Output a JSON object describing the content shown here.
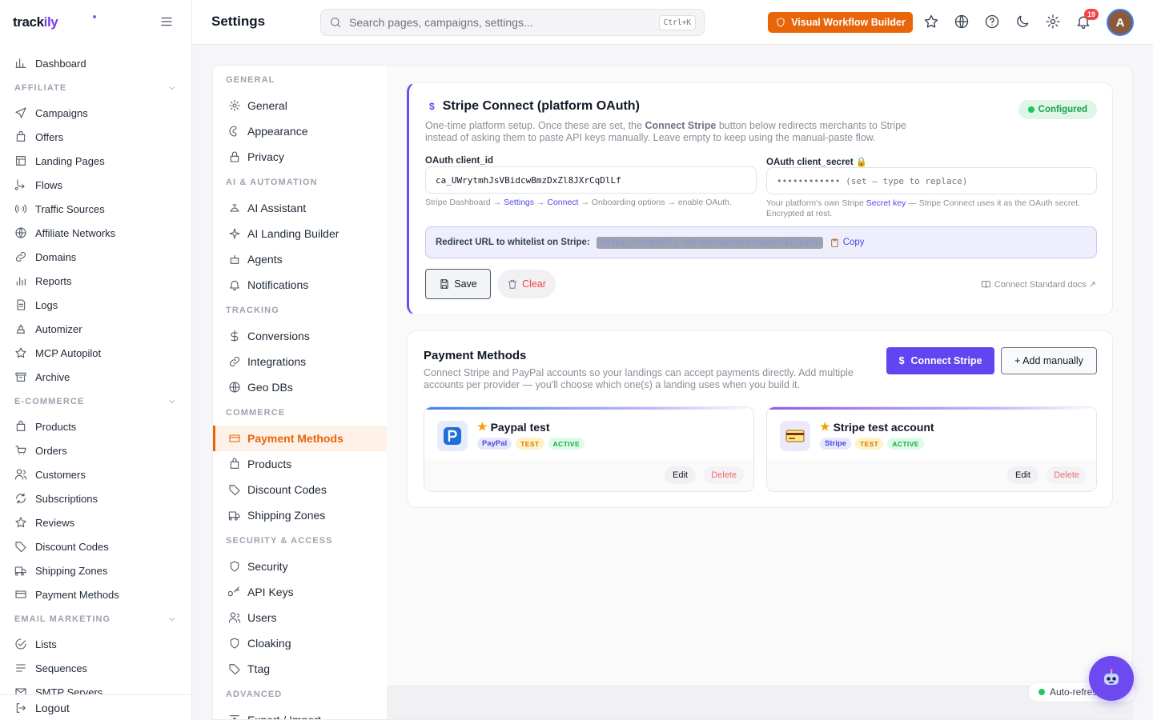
{
  "sidebar": {
    "logo_main": "track",
    "logo_accent": "ily",
    "items_top": [
      {
        "label": "Dashboard",
        "icon": "bar-chart-icon"
      }
    ],
    "sections": [
      {
        "title": "AFFILIATE",
        "items": [
          {
            "label": "Campaigns"
          },
          {
            "label": "Offers"
          },
          {
            "label": "Landing Pages"
          },
          {
            "label": "Flows"
          },
          {
            "label": "Traffic Sources"
          },
          {
            "label": "Affiliate Networks"
          },
          {
            "label": "Domains"
          },
          {
            "label": "Reports"
          },
          {
            "label": "Logs"
          },
          {
            "label": "Automizer"
          },
          {
            "label": "MCP Autopilot"
          },
          {
            "label": "Archive"
          }
        ]
      },
      {
        "title": "E-COMMERCE",
        "items": [
          {
            "label": "Products"
          },
          {
            "label": "Orders"
          },
          {
            "label": "Customers"
          },
          {
            "label": "Subscriptions"
          },
          {
            "label": "Reviews"
          },
          {
            "label": "Discount Codes"
          },
          {
            "label": "Shipping Zones"
          },
          {
            "label": "Payment Methods"
          }
        ]
      },
      {
        "title": "EMAIL MARKETING",
        "items": [
          {
            "label": "Lists"
          },
          {
            "label": "Sequences"
          },
          {
            "label": "SMTP Servers"
          }
        ]
      }
    ],
    "logout": "Logout"
  },
  "topbar": {
    "title": "Settings",
    "search_placeholder": "Search pages, campaigns, settings...",
    "search_shortcut": "Ctrl+K",
    "workflow_button": "Visual Workflow Builder",
    "notification_count": "19",
    "avatar_initial": "A"
  },
  "settings_nav": {
    "sections": [
      {
        "title": "GENERAL",
        "items": [
          {
            "label": "General"
          },
          {
            "label": "Appearance"
          },
          {
            "label": "Privacy"
          }
        ]
      },
      {
        "title": "AI & AUTOMATION",
        "items": [
          {
            "label": "AI Assistant"
          },
          {
            "label": "AI Landing Builder"
          },
          {
            "label": "Agents"
          },
          {
            "label": "Notifications"
          }
        ]
      },
      {
        "title": "TRACKING",
        "items": [
          {
            "label": "Conversions"
          },
          {
            "label": "Integrations"
          },
          {
            "label": "Geo DBs"
          }
        ]
      },
      {
        "title": "COMMERCE",
        "items": [
          {
            "label": "Payment Methods",
            "active": true
          },
          {
            "label": "Products"
          },
          {
            "label": "Discount Codes"
          },
          {
            "label": "Shipping Zones"
          }
        ]
      },
      {
        "title": "SECURITY & ACCESS",
        "items": [
          {
            "label": "Security"
          },
          {
            "label": "API Keys"
          },
          {
            "label": "Users"
          },
          {
            "label": "Cloaking"
          },
          {
            "label": "Ttag"
          }
        ]
      },
      {
        "title": "ADVANCED",
        "items": [
          {
            "label": "Export / Import"
          }
        ]
      }
    ]
  },
  "stripe_connect": {
    "icon_glyph": "$",
    "title": "Stripe Connect (platform OAuth)",
    "status": "Configured",
    "desc_prefix": "One-time platform setup. Once these are set, the ",
    "desc_bold": "Connect Stripe",
    "desc_suffix": " button below redirects merchants to Stripe instead of asking them to paste API keys manually. Leave empty to keep using the manual-paste flow.",
    "client_id_label": "OAuth client_id",
    "client_id_value": "ca_UWrytmhJsVBidcwBmzDxZl8JXrCqDlLf",
    "client_id_help_prefix": "Stripe Dashboard → ",
    "client_id_help_link1": "Settings",
    "client_id_help_arrow": " → ",
    "client_id_help_link2": "Connect",
    "client_id_help_suffix": " → Onboarding options → enable OAuth.",
    "client_secret_label": "OAuth client_secret",
    "client_secret_lock": "🔒",
    "client_secret_placeholder": "•••••••••••• (set — type to replace)",
    "client_secret_help_prefix": "Your platform's own Stripe ",
    "client_secret_help_link": "Secret key",
    "client_secret_help_suffix": " — Stripe Connect uses it as the OAuth secret. Encrypted at rest.",
    "redirect_label": "Redirect URL to whitelist on Stripe:",
    "redirect_url": "https://trackily.online/oauth/stripe/callback",
    "copy_label": "Copy",
    "save_label": "Save",
    "clear_label": "Clear",
    "docs_label": "Connect Standard docs ↗"
  },
  "payment_methods": {
    "title": "Payment Methods",
    "description": "Connect Stripe and PayPal accounts so your landings can accept payments directly. Add multiple accounts per provider — you'll choose which one(s) a landing uses when you build it.",
    "connect_stripe_label": "Connect Stripe",
    "connect_stripe_glyph": "$",
    "add_manually_label": "+ Add manually",
    "accounts": [
      {
        "name": "Paypal test",
        "provider": "PayPal",
        "mode": "TEST",
        "status": "ACTIVE",
        "edit": "Edit",
        "delete": "Delete",
        "icon": "paypal-logo-icon",
        "accent": "#3b82f6"
      },
      {
        "name": "Stripe test account",
        "provider": "Stripe",
        "mode": "TEST",
        "status": "ACTIVE",
        "edit": "Edit",
        "delete": "Delete",
        "icon": "credit-card-icon",
        "accent": "#8b5cf6"
      }
    ]
  },
  "auto_refresh_label": "Auto-refresh",
  "colors": {
    "brand": "#e8650a",
    "accent": "#6145f1",
    "success": "#22c55e",
    "danger": "#ef4444"
  }
}
